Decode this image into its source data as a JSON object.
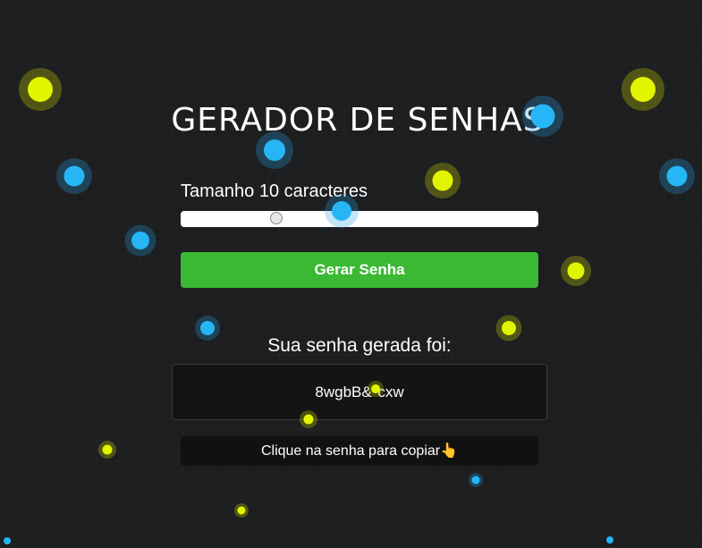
{
  "app": {
    "title": "GERADOR DE SENHAS"
  },
  "length_control": {
    "label_prefix": "Tamanho",
    "value": "10",
    "label_suffix": "caracteres",
    "slider_fraction": 0.26
  },
  "generate_button": {
    "label": "Gerar Senha"
  },
  "result": {
    "title": "Sua senha gerada foi:",
    "password": "8wgbB&*cxw"
  },
  "copy_hint": {
    "text": "Clique na senha para copiar👆"
  },
  "colors": {
    "background": "#1d1e20",
    "accent_green": "#3cb934",
    "particle_blue": "#26b6f5",
    "particle_yellow": "#e2f500"
  }
}
